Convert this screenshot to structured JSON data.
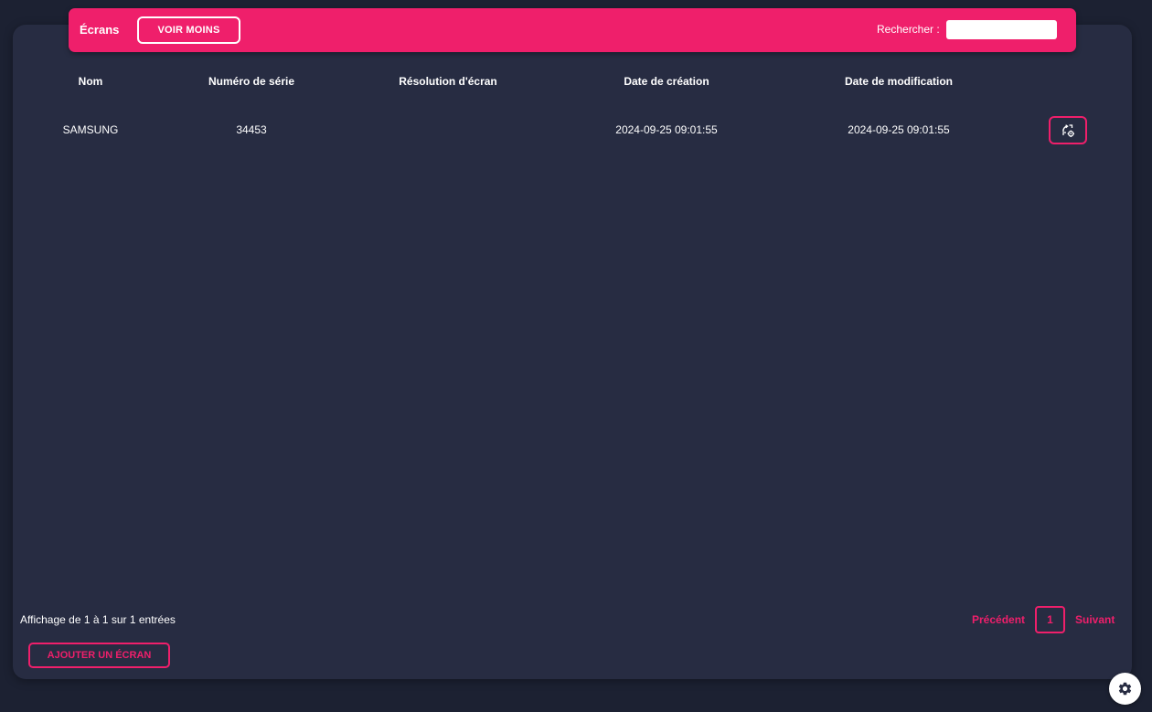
{
  "header": {
    "title": "Écrans",
    "toggle_label": "VOIR MOINS",
    "search_label": "Rechercher :",
    "search_value": ""
  },
  "table": {
    "columns": [
      "Nom",
      "Numéro de série",
      "Résolution d'écran",
      "Date de création",
      "Date de modification"
    ],
    "rows": [
      {
        "nom": "SAMSUNG",
        "numero_serie": "34453",
        "resolution": "",
        "date_creation": "2024-09-25 09:01:55",
        "date_modification": "2024-09-25 09:01:55",
        "action_icon": "rotate-settings-icon"
      }
    ]
  },
  "footer": {
    "info": "Affichage de 1 à 1 sur 1 entrées",
    "pagination": {
      "previous": "Précédent",
      "current_page": "1",
      "next": "Suivant"
    },
    "add_button": "AJOUTER UN ÉCRAN"
  },
  "settings_icon": "gear-icon",
  "colors": {
    "accent": "#ef1f6b",
    "page_background": "#1c2132",
    "card_background": "#272c42",
    "text": "#ffffff"
  }
}
